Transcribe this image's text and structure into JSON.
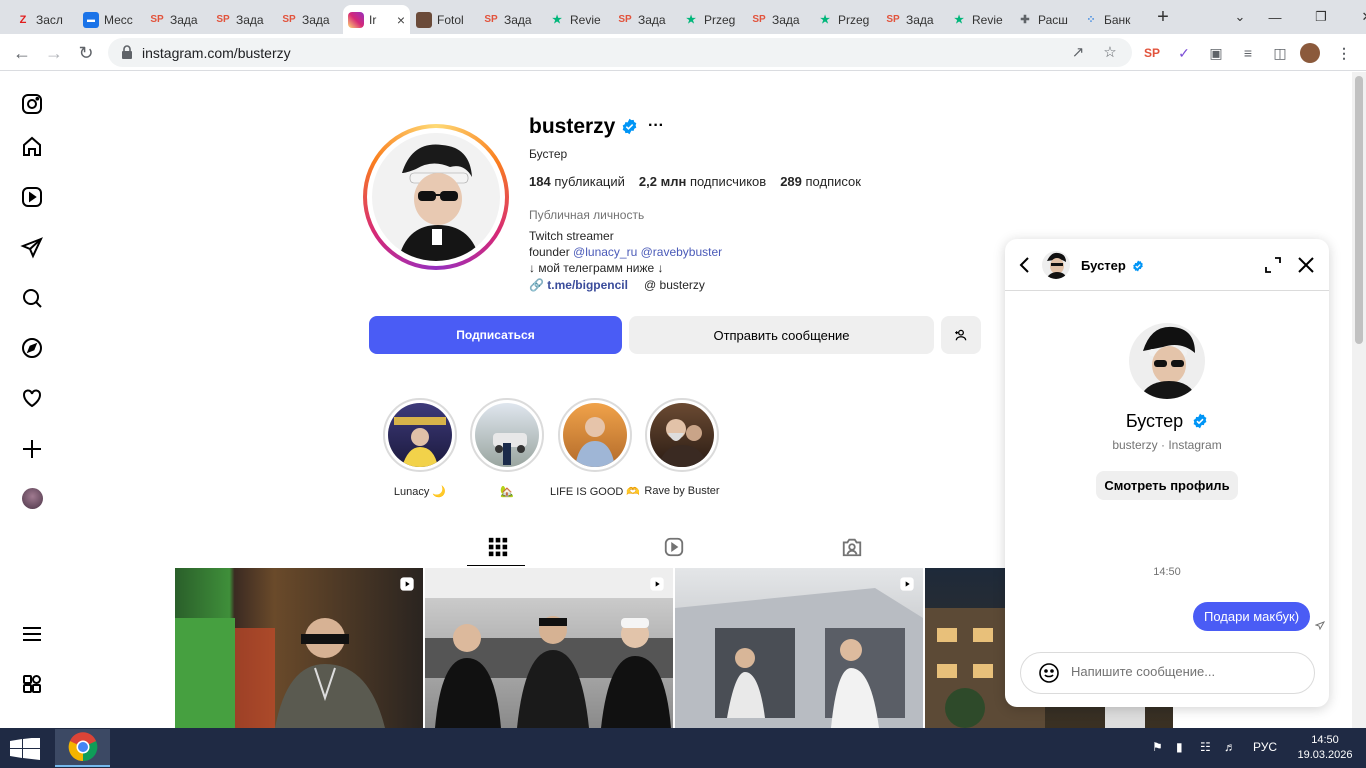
{
  "browser": {
    "tabs": [
      {
        "label": "Засл",
        "fav": "Z",
        "color": "#e11d1d"
      },
      {
        "label": "Месс",
        "fav": "message-icon",
        "color": "#1a73e8"
      },
      {
        "label": "Зада",
        "fav": "SP",
        "color": "#e2533c"
      },
      {
        "label": "Зада",
        "fav": "SP",
        "color": "#e2533c"
      },
      {
        "label": "Зада",
        "fav": "SP",
        "color": "#e2533c"
      },
      {
        "label": "Ir",
        "fav": "instagram-icon",
        "color": "#d62976",
        "active": true
      },
      {
        "label": "Fotol",
        "fav": "photo-icon",
        "color": "#6b4b3a"
      },
      {
        "label": "Зада",
        "fav": "SP",
        "color": "#e2533c"
      },
      {
        "label": "Revie",
        "fav": "star-icon",
        "color": "#00b67a"
      },
      {
        "label": "Зада",
        "fav": "SP",
        "color": "#e2533c"
      },
      {
        "label": "Przeg",
        "fav": "star-icon",
        "color": "#00b67a"
      },
      {
        "label": "Зада",
        "fav": "SP",
        "color": "#e2533c"
      },
      {
        "label": "Przeg",
        "fav": "star-icon",
        "color": "#00b67a"
      },
      {
        "label": "Зада",
        "fav": "SP",
        "color": "#e2533c"
      },
      {
        "label": "Revie",
        "fav": "star-icon",
        "color": "#00b67a"
      },
      {
        "label": "Расш",
        "fav": "puzzle-icon",
        "color": "#5f6368"
      },
      {
        "label": "Банк",
        "fav": "dots-icon",
        "color": "#4a90e2"
      }
    ],
    "url": "instagram.com/busterzy"
  },
  "profile": {
    "username": "busterzy",
    "full_name": "Бустер",
    "posts": "184",
    "posts_label": "публикаций",
    "followers": "2,2 млн",
    "followers_label": "подписчиков",
    "following": "289",
    "following_label": "подписок",
    "category": "Публичная личность",
    "bio_line1": "Twitch streamer",
    "bio_founder": "founder",
    "bio_mention1": "@lunacy_ru",
    "bio_mention2": "@ravebybuster",
    "bio_line3": "↓ мой телеграмм ниже ↓",
    "link": "t.me/bigpencil",
    "threads": "busterzy",
    "follow_label": "Подписаться",
    "message_label": "Отправить сообщение"
  },
  "highlights": [
    {
      "label": "Lunacy 🌙"
    },
    {
      "label": "🏡"
    },
    {
      "label": "LIFE IS GOOD 🫶"
    },
    {
      "label": "Rave by Buster"
    }
  ],
  "chat": {
    "name": "Бустер",
    "big_name": "Бустер",
    "subtitle": "busterzy · Instagram",
    "view_profile": "Смотреть профиль",
    "time": "14:50",
    "message": "Подари макбук)",
    "input_placeholder": "Напишите сообщение..."
  },
  "taskbar": {
    "lang": "РУС",
    "time": "14:50",
    "date": "19.03.2026"
  },
  "colors": {
    "ig_blue": "#4a5cf5",
    "verified": "#0095f6",
    "taskbar": "#1f2a44"
  }
}
